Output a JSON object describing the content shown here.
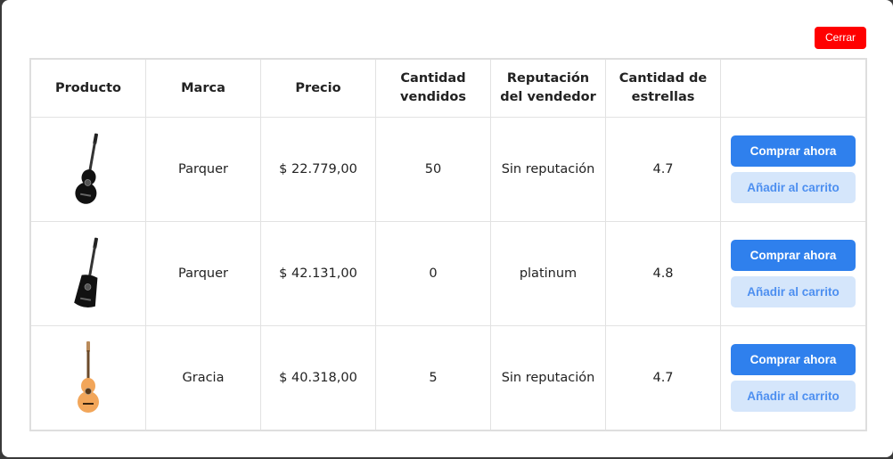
{
  "modal": {
    "close_label": "Cerrar"
  },
  "table": {
    "headers": [
      "Producto",
      "Marca",
      "Precio",
      "Cantidad vendidos",
      "Reputación del vendedor",
      "Cantidad de estrellas",
      ""
    ],
    "rows": [
      {
        "image": "black-classical-guitar",
        "brand": "Parquer",
        "price": "$ 22.779,00",
        "sold": "50",
        "reputation": "Sin reputación",
        "stars": "4.7",
        "buy_label": "Comprar ahora",
        "cart_label": "Añadir al carrito"
      },
      {
        "image": "black-acoustic-guitar",
        "brand": "Parquer",
        "price": "$ 42.131,00",
        "sold": "0",
        "reputation": "platinum",
        "stars": "4.8",
        "buy_label": "Comprar ahora",
        "cart_label": "Añadir al carrito"
      },
      {
        "image": "natural-classical-guitar",
        "brand": "Gracia",
        "price": "$ 40.318,00",
        "sold": "5",
        "reputation": "Sin reputación",
        "stars": "4.7",
        "buy_label": "Comprar ahora",
        "cart_label": "Añadir al carrito"
      }
    ]
  },
  "colors": {
    "close": "#ff0000",
    "primary": "#2f80ed",
    "secondary_bg": "#d5e6fb",
    "guitar_black": "#111111",
    "guitar_natural": "#f2a65a"
  }
}
